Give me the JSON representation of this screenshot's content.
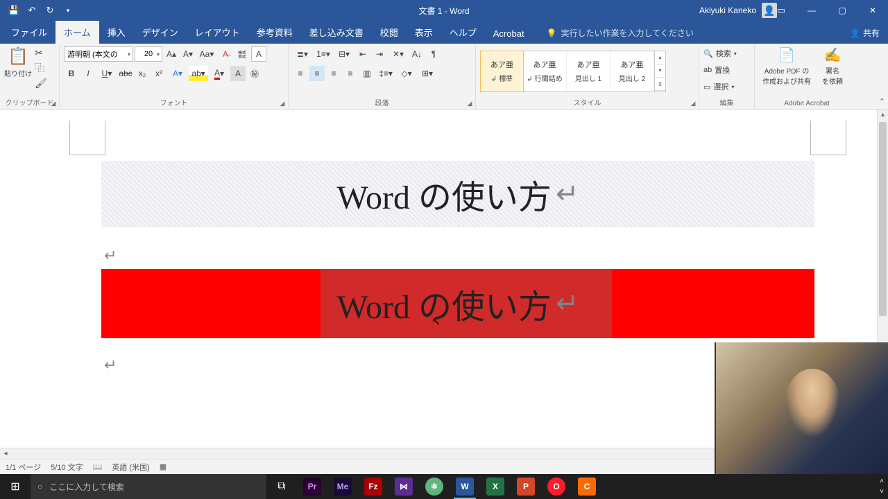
{
  "titlebar": {
    "title": "文書 1  -  Word",
    "user": "Akiyuki Kaneko"
  },
  "tabs": {
    "file": "ファイル",
    "home": "ホーム",
    "insert": "挿入",
    "design": "デザイン",
    "layout": "レイアウト",
    "references": "参考資料",
    "mailings": "差し込み文書",
    "review": "校閲",
    "view": "表示",
    "help": "ヘルプ",
    "acrobat": "Acrobat",
    "tellme": "実行したい作業を入力してください",
    "share": "共有"
  },
  "ribbon": {
    "clipboard": {
      "label": "クリップボード",
      "paste": "貼り付け"
    },
    "font": {
      "label": "フォント",
      "name": "游明朝 (本文の",
      "size": "20"
    },
    "paragraph": {
      "label": "段落"
    },
    "styles": {
      "label": "スタイル",
      "items": [
        {
          "preview": "あア亜",
          "name": "↲ 標準"
        },
        {
          "preview": "あア亜",
          "name": "↲ 行間詰め"
        },
        {
          "preview": "あア亜",
          "name": "見出し 1"
        },
        {
          "preview": "あア亜",
          "name": "見出し 2"
        }
      ]
    },
    "editing": {
      "label": "編集",
      "find": "検索",
      "replace": "置換",
      "select": "選択"
    },
    "acrobat": {
      "label": "Adobe Acrobat",
      "create": "Adobe PDF の\n作成および共有",
      "sign": "署名\nを依頼"
    }
  },
  "document": {
    "line1": "Word の使い方",
    "line2": "Word の使い方"
  },
  "status": {
    "page": "1/1 ページ",
    "words": "5/10 文字",
    "lang": "英語 (米国)"
  },
  "taskbar": {
    "search_placeholder": "ここに入力して検索"
  }
}
